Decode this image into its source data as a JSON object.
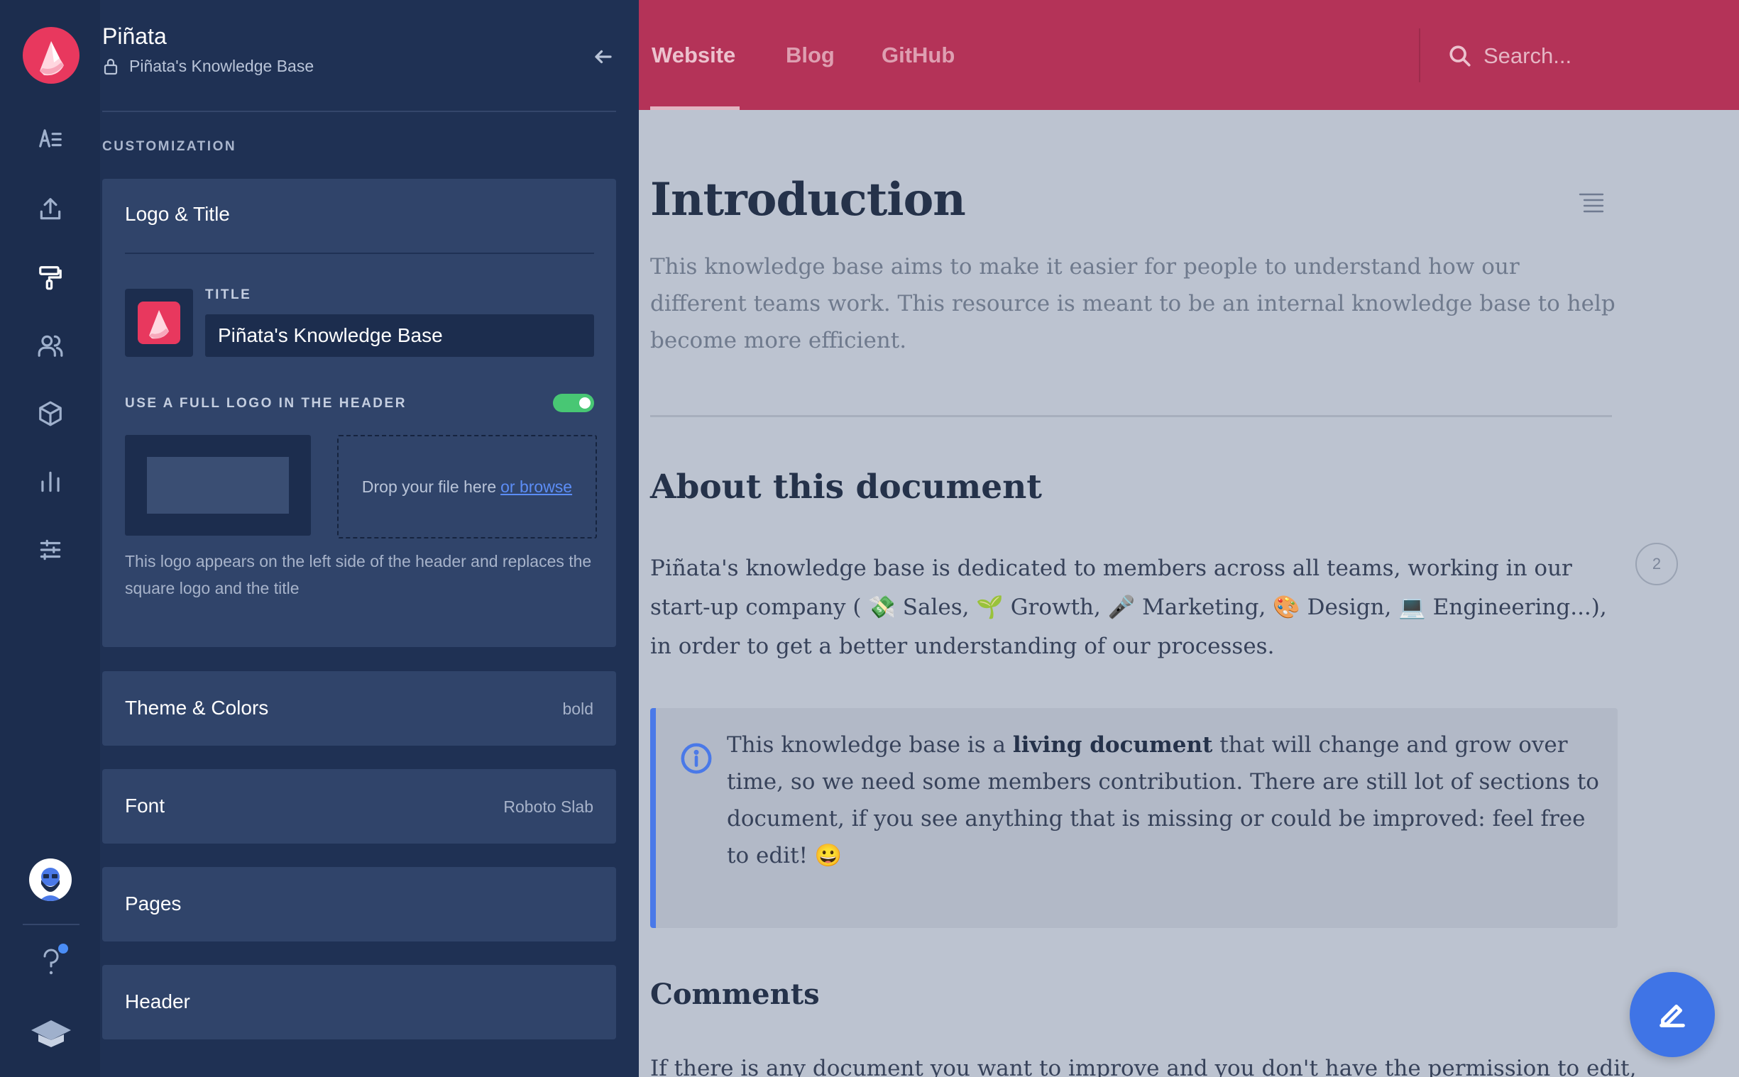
{
  "app": {
    "name": "Piñata",
    "space_name": "Piñata's Knowledge Base"
  },
  "sidebar": {
    "section_label": "CUSTOMIZATION",
    "rail_items": [
      "content-icon",
      "publish-icon",
      "customize-icon",
      "members-icon",
      "integrations-icon",
      "analytics-icon",
      "settings-icon"
    ],
    "cards": {
      "logo_title": {
        "title": "Logo & Title",
        "field_label": "TITLE",
        "title_value": "Piñata's Knowledge Base",
        "toggle_label": "USE A FULL LOGO IN THE HEADER",
        "toggle_on": true,
        "drop_text": "Drop your file here",
        "browse_link": "or browse",
        "help_text": "This logo appears on the left side of the header and replaces the square logo and the title"
      },
      "theme": {
        "title": "Theme & Colors",
        "value": "bold"
      },
      "font": {
        "title": "Font",
        "value": "Roboto Slab"
      },
      "pages": {
        "title": "Pages"
      },
      "header": {
        "title": "Header"
      }
    }
  },
  "topbar": {
    "tabs": [
      "Website",
      "Blog",
      "GitHub"
    ],
    "active_tab": "Website",
    "search_placeholder": "Search...",
    "color": "#b43358"
  },
  "doc": {
    "title": "Introduction",
    "intro": "This knowledge base aims to make it easier for people to understand how our different teams work. This resource is meant to be an internal knowledge base to help become more efficient.",
    "section1_title": "About this document",
    "section1_line1": "Piñata's knowledge base is dedicated to members across all teams, working in our start-up company ( 💸 Sales, 🌱 Growth, 🎤 Marketing, 🎨 Design, 💻 Engineering...), in order to get a better understanding of our processes.",
    "comment_count": "2",
    "callout_before": "This knowledge base is a ",
    "callout_bold": "living document",
    "callout_after": " that will change and grow over time, so we need some members contribution. There are still lot of sections to document, if you see anything that is missing or could be improved: feel free to edit! 😀",
    "section2_title": "Comments",
    "section2_text": "If there is any document you want to improve and you don't have the permission to edit,"
  },
  "colors": {
    "accent": "#b43358",
    "sidebar_bg": "#1f3154",
    "rail_bg": "#1c2d4e",
    "info": "#4a79e8",
    "toggle_on": "#48c774"
  }
}
